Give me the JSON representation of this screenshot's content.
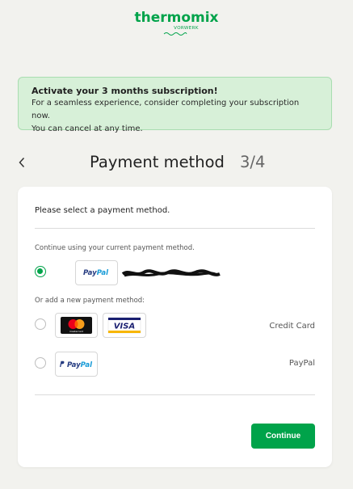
{
  "brand": {
    "name": "thermomix",
    "sub": "VORWERK",
    "color": "#00a34a"
  },
  "banner": {
    "title": "Activate your 3 months subscription!",
    "line1": "For a seamless experience, consider completing your subscription now.",
    "line2": "You can cancel at any time."
  },
  "header": {
    "back_icon": "chevron-left-icon",
    "title": "Payment method",
    "step": "3/4"
  },
  "card": {
    "prompt": "Please select a payment method.",
    "current_label": "Continue using your current payment method.",
    "current_method": {
      "provider": "PayPal",
      "account": "redacted",
      "selected": true
    },
    "new_label": "Or add a new payment method:",
    "options": [
      {
        "label": "Credit Card",
        "logos": [
          "mastercard",
          "VISA"
        ],
        "selected": false
      },
      {
        "label": "PayPal",
        "logos": [
          "paypal"
        ],
        "selected": false
      }
    ],
    "continue_label": "Continue"
  },
  "logos": {
    "paypal_a": "Pay",
    "paypal_b": "Pal",
    "mastercard_caption": "mastercard",
    "visa": "VISA"
  }
}
